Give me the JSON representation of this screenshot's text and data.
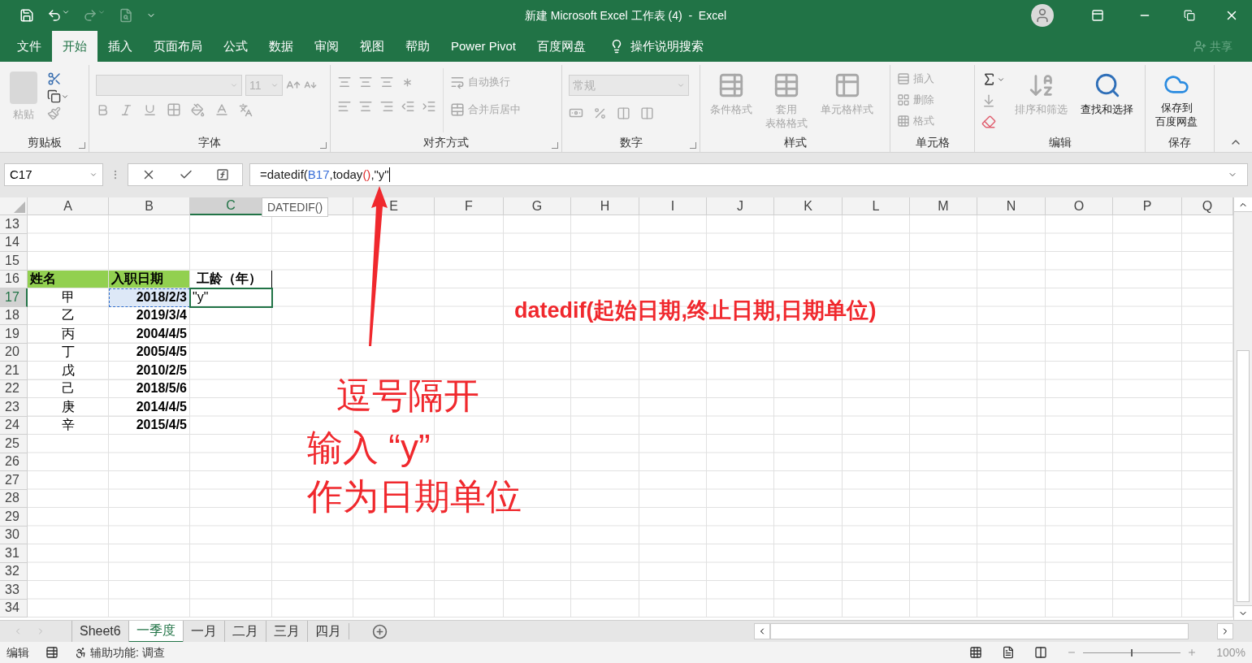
{
  "title": "新建 Microsoft Excel 工作表 (4)  -  Excel",
  "menu_tabs": [
    {
      "label": "文件",
      "selected": false
    },
    {
      "label": "开始",
      "selected": true
    },
    {
      "label": "插入",
      "selected": false
    },
    {
      "label": "页面布局",
      "selected": false
    },
    {
      "label": "公式",
      "selected": false
    },
    {
      "label": "数据",
      "selected": false
    },
    {
      "label": "审阅",
      "selected": false
    },
    {
      "label": "视图",
      "selected": false
    },
    {
      "label": "帮助",
      "selected": false
    },
    {
      "label": "Power Pivot",
      "selected": false
    },
    {
      "label": "百度网盘",
      "selected": false
    }
  ],
  "tell_me": "操作说明搜索",
  "share": "共享",
  "ribbon": [
    {
      "label": "剪贴板",
      "buttons": [
        {
          "label": "粘贴",
          "disabled": true
        }
      ]
    },
    {
      "label": "字体",
      "size": "11"
    },
    {
      "label": "对齐方式",
      "buttons": [
        {
          "label": "自动换行",
          "disabled": true
        },
        {
          "label": "合并后居中",
          "disabled": true
        }
      ]
    },
    {
      "label": "数字",
      "format": "常规"
    },
    {
      "label": "样式",
      "buttons": [
        {
          "label": "条件格式",
          "disabled": true
        },
        {
          "lines": [
            "套用",
            "表格格式"
          ],
          "disabled": true
        },
        {
          "label": "单元格样式",
          "disabled": true
        }
      ]
    },
    {
      "label": "单元格",
      "buttons": [
        {
          "label": "插入",
          "disabled": true
        },
        {
          "label": "删除",
          "disabled": true
        },
        {
          "label": "格式",
          "disabled": true
        }
      ]
    },
    {
      "label": "编辑",
      "buttons": [
        {
          "label": "排序和筛选",
          "disabled": true
        },
        {
          "label": "查找和选择",
          "disabled": false
        }
      ]
    },
    {
      "label": "保存",
      "buttons": [
        {
          "lines": [
            "保存到",
            "百度网盘"
          ],
          "disabled": false
        }
      ]
    }
  ],
  "name_box": "C17",
  "formula": [
    {
      "kind": "plain",
      "text": "=datedif("
    },
    {
      "kind": "ref",
      "text": "B17"
    },
    {
      "kind": "plain",
      "text": ",today"
    },
    {
      "kind": "paren",
      "text": "()"
    },
    {
      "kind": "plain",
      "text": ",\"y\""
    }
  ],
  "tooltip": "DATEDIF()",
  "columns": [
    {
      "label": "A",
      "selected": false
    },
    {
      "label": "B",
      "selected": false
    },
    {
      "label": "C",
      "selected": true
    },
    {
      "selected": false
    },
    {
      "label": "E",
      "selected": false
    },
    {
      "label": "F",
      "selected": false
    },
    {
      "label": "G",
      "selected": false
    },
    {
      "label": "H",
      "selected": false
    },
    {
      "label": "I",
      "selected": false
    },
    {
      "label": "J",
      "selected": false
    },
    {
      "label": "K",
      "selected": false
    },
    {
      "label": "L",
      "selected": false
    },
    {
      "label": "M",
      "selected": false
    },
    {
      "label": "N",
      "selected": false
    },
    {
      "label": "O",
      "selected": false
    },
    {
      "label": "P",
      "selected": false
    },
    {
      "label": "Q",
      "selected": false
    }
  ],
  "rows": [
    {
      "number": "13",
      "selected": false
    },
    {
      "number": "14",
      "selected": false
    },
    {
      "number": "15",
      "selected": false
    },
    {
      "number": "16",
      "selected": false,
      "kind": "header",
      "cells": [
        "姓名",
        "入职日期",
        "工龄（年）"
      ]
    },
    {
      "number": "17",
      "selected": true,
      "kind": "data",
      "cells": [
        "甲",
        "2018/2/3",
        "\"y\""
      ]
    },
    {
      "number": "18",
      "selected": false,
      "kind": "data",
      "cells": [
        "乙",
        "2019/3/4"
      ]
    },
    {
      "number": "19",
      "selected": false,
      "kind": "data",
      "cells": [
        "丙",
        "2004/4/5"
      ]
    },
    {
      "number": "20",
      "selected": false,
      "kind": "data",
      "cells": [
        "丁",
        "2005/4/5"
      ]
    },
    {
      "number": "21",
      "selected": false,
      "kind": "data",
      "cells": [
        "戊",
        "2010/2/5"
      ]
    },
    {
      "number": "22",
      "selected": false,
      "kind": "data",
      "cells": [
        "己",
        "2018/5/6"
      ]
    },
    {
      "number": "23",
      "selected": false,
      "kind": "data",
      "cells": [
        "庚",
        "2014/4/5"
      ]
    },
    {
      "number": "24",
      "selected": false,
      "kind": "data",
      "cells": [
        "辛",
        "2015/4/5"
      ]
    },
    {
      "number": "25",
      "selected": false
    },
    {
      "number": "26",
      "selected": false
    },
    {
      "number": "27",
      "selected": false
    },
    {
      "number": "28",
      "selected": false
    },
    {
      "number": "29",
      "selected": false
    },
    {
      "number": "30",
      "selected": false
    },
    {
      "number": "31",
      "selected": false
    },
    {
      "number": "32",
      "selected": false
    },
    {
      "number": "33",
      "selected": false
    },
    {
      "number": "34",
      "selected": false
    }
  ],
  "annotations": [
    "datedif(起始日期,终止日期,日期单位)",
    "逗号隔开",
    "输入 “y”",
    "作为日期单位"
  ],
  "sheets": [
    {
      "label": "Sheet6",
      "selected": false
    },
    {
      "label": "一季度",
      "selected": true
    },
    {
      "label": "一月",
      "selected": false
    },
    {
      "label": "二月",
      "selected": false
    },
    {
      "label": "三月",
      "selected": false
    },
    {
      "label": "四月",
      "selected": false
    }
  ],
  "status": {
    "mode": "编辑",
    "accessibility": "辅助功能: 调查",
    "zoom": "100%",
    "zoom_slider": {
      "level": 0.5
    }
  }
}
